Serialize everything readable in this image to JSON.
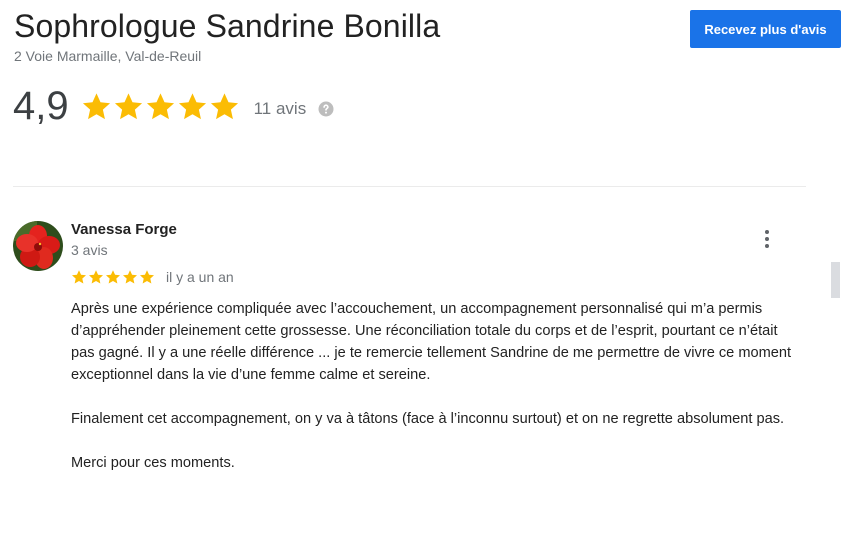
{
  "business": {
    "name": "Sophrologue Sandrine Bonilla",
    "address": "2 Voie Marmaille, Val-de-Reuil",
    "cta_label": "Recevez plus d'avis",
    "rating": "4,9",
    "stars": 5,
    "review_count": "11 avis",
    "colors": {
      "accent": "#1a73e8",
      "star": "#fbbc04"
    }
  },
  "review": {
    "author": "Vanessa Forge",
    "author_review_count": "3 avis",
    "stars": 5,
    "date": "il y a un an",
    "paragraphs": [
      "Après une expérience compliquée avec l’accouchement, un accompagnement personnalisé qui m’a permis d’appréhender pleinement cette grossesse. Une réconciliation totale du corps et de l’esprit, pourtant ce n’était pas gagné. Il y a une réelle différence ... je te remercie tellement Sandrine de me permettre de vivre ce moment exceptionnel dans la vie d’une femme calme et sereine.",
      "Finalement cet accompagnement, on y va à tâtons (face à l’inconnu surtout) et on ne regrette absolument pas.",
      "Merci pour ces moments."
    ]
  },
  "icons": {
    "help": "help-circle-icon",
    "menu": "more-vert-icon",
    "star": "star-icon",
    "avatar": "red-hibiscus-flower"
  }
}
